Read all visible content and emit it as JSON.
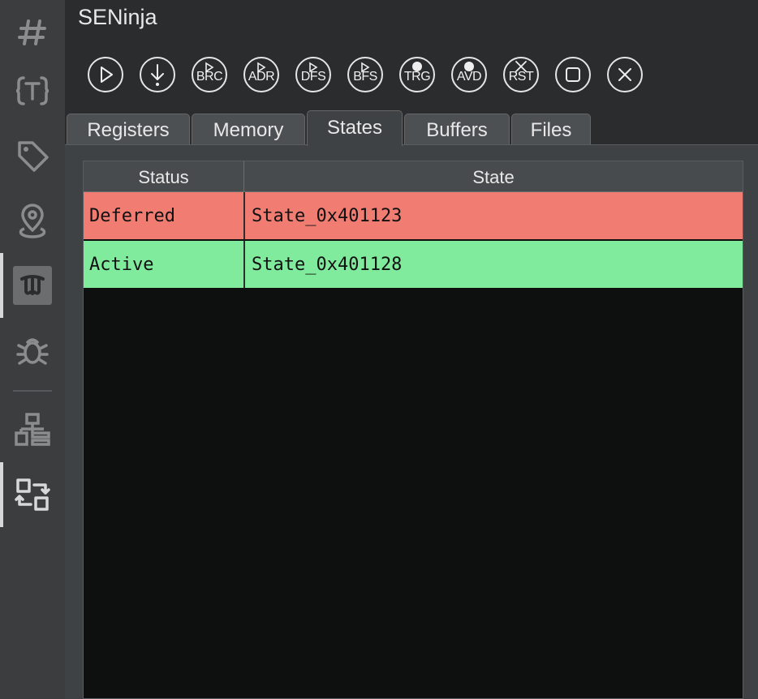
{
  "app": {
    "title": "SENinja"
  },
  "sidebar": {
    "items": [
      {
        "icon": "hash-icon"
      },
      {
        "icon": "types-icon"
      },
      {
        "icon": "tag-icon"
      },
      {
        "icon": "location-pin-icon"
      },
      {
        "icon": "seninja-logo-icon"
      },
      {
        "icon": "bug-icon"
      },
      {
        "icon": "hierarchy-icon"
      },
      {
        "icon": "swap-icon"
      }
    ]
  },
  "toolbar": {
    "buttons": [
      {
        "name": "play-button",
        "label": ""
      },
      {
        "name": "step-button",
        "label": ""
      },
      {
        "name": "brc-button",
        "label": "BRC"
      },
      {
        "name": "adr-button",
        "label": "ADR"
      },
      {
        "name": "dfs-button",
        "label": "DFS"
      },
      {
        "name": "bfs-button",
        "label": "BFS"
      },
      {
        "name": "trg-button",
        "label": "TRG"
      },
      {
        "name": "avd-button",
        "label": "AVD"
      },
      {
        "name": "rst-button",
        "label": "RST"
      },
      {
        "name": "stop-button",
        "label": ""
      },
      {
        "name": "close-button",
        "label": ""
      }
    ]
  },
  "tabs": [
    {
      "label": "Registers"
    },
    {
      "label": "Memory"
    },
    {
      "label": "States"
    },
    {
      "label": "Buffers"
    },
    {
      "label": "Files"
    }
  ],
  "states_table": {
    "headers": {
      "status": "Status",
      "state": "State"
    },
    "rows": [
      {
        "status": "Deferred",
        "state": "State_0x401123",
        "color": "#f07c72"
      },
      {
        "status": "Active",
        "state": "State_0x401128",
        "color": "#80eb9c"
      }
    ]
  }
}
